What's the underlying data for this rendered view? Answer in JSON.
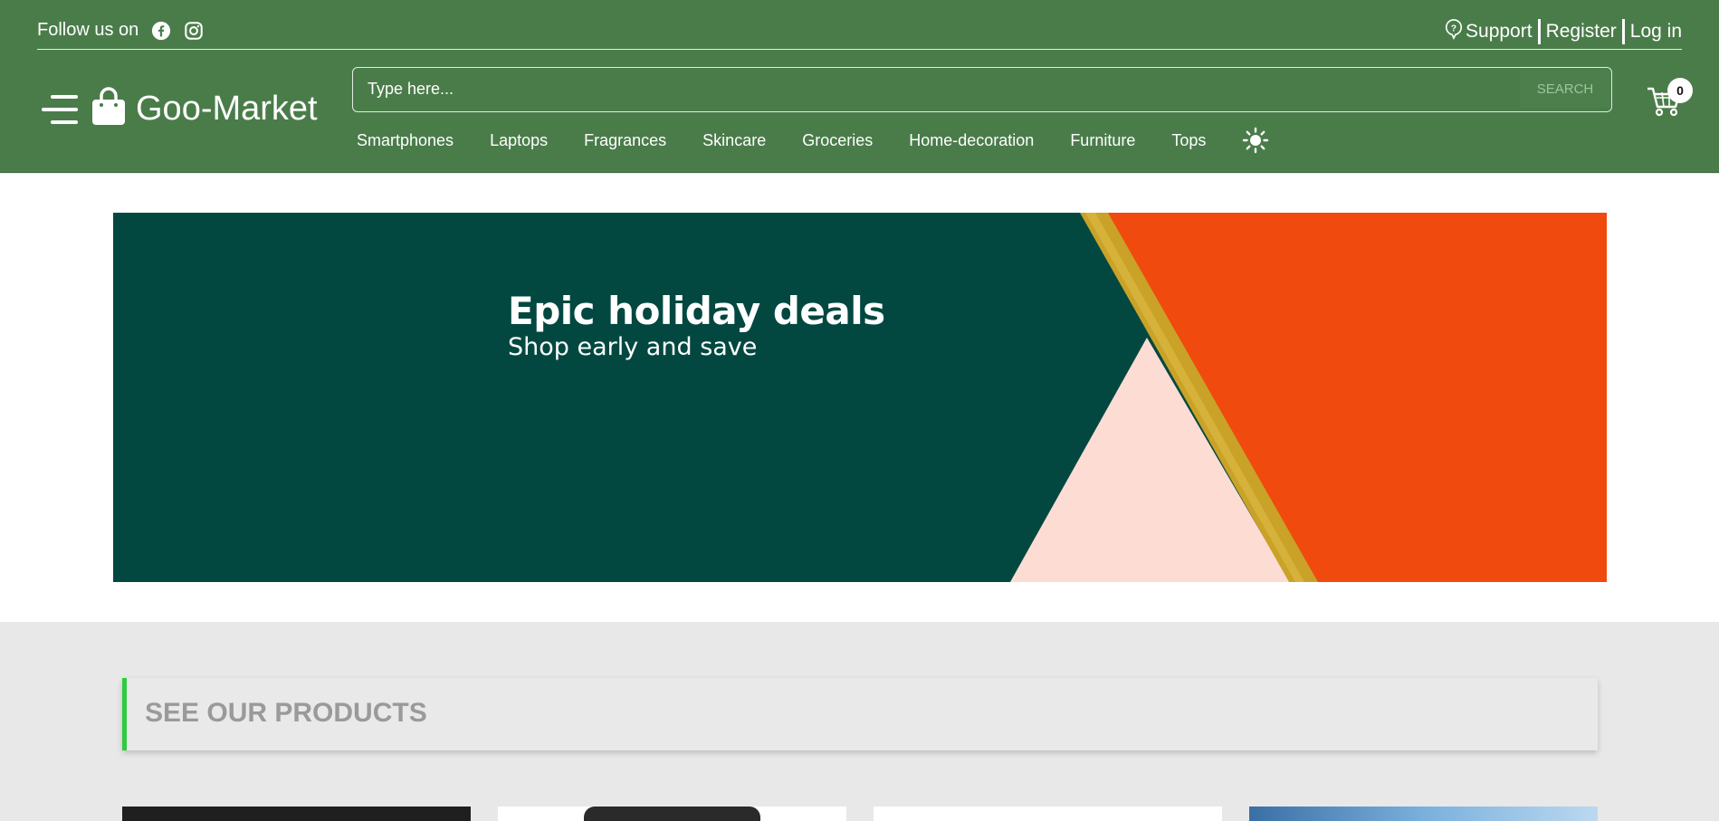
{
  "topbar": {
    "follow_label": "Follow us on",
    "social_icons": [
      "facebook-icon",
      "instagram-icon"
    ],
    "support_label": "Support",
    "register_label": "Register",
    "login_label": "Log in"
  },
  "brand": {
    "name": "Goo-Market",
    "icon": "shopping-bag-icon"
  },
  "search": {
    "placeholder": "Type here...",
    "button_label": "SEARCH"
  },
  "categories": [
    "Smartphones",
    "Laptops",
    "Fragrances",
    "Skincare",
    "Groceries",
    "Home-decoration",
    "Furniture",
    "Tops"
  ],
  "cart": {
    "count": "0"
  },
  "banner": {
    "title": "Epic holiday deals",
    "subtitle": "Shop early and save"
  },
  "products": {
    "heading": "SEE OUR PRODUCTS"
  },
  "colors": {
    "header_bg": "#4a7c4a",
    "banner_bg": "#024840",
    "banner_orange": "#f04a0e",
    "banner_pink": "#fddcd4",
    "banner_gold": "#c9a227",
    "accent_green": "#2ecc40"
  }
}
